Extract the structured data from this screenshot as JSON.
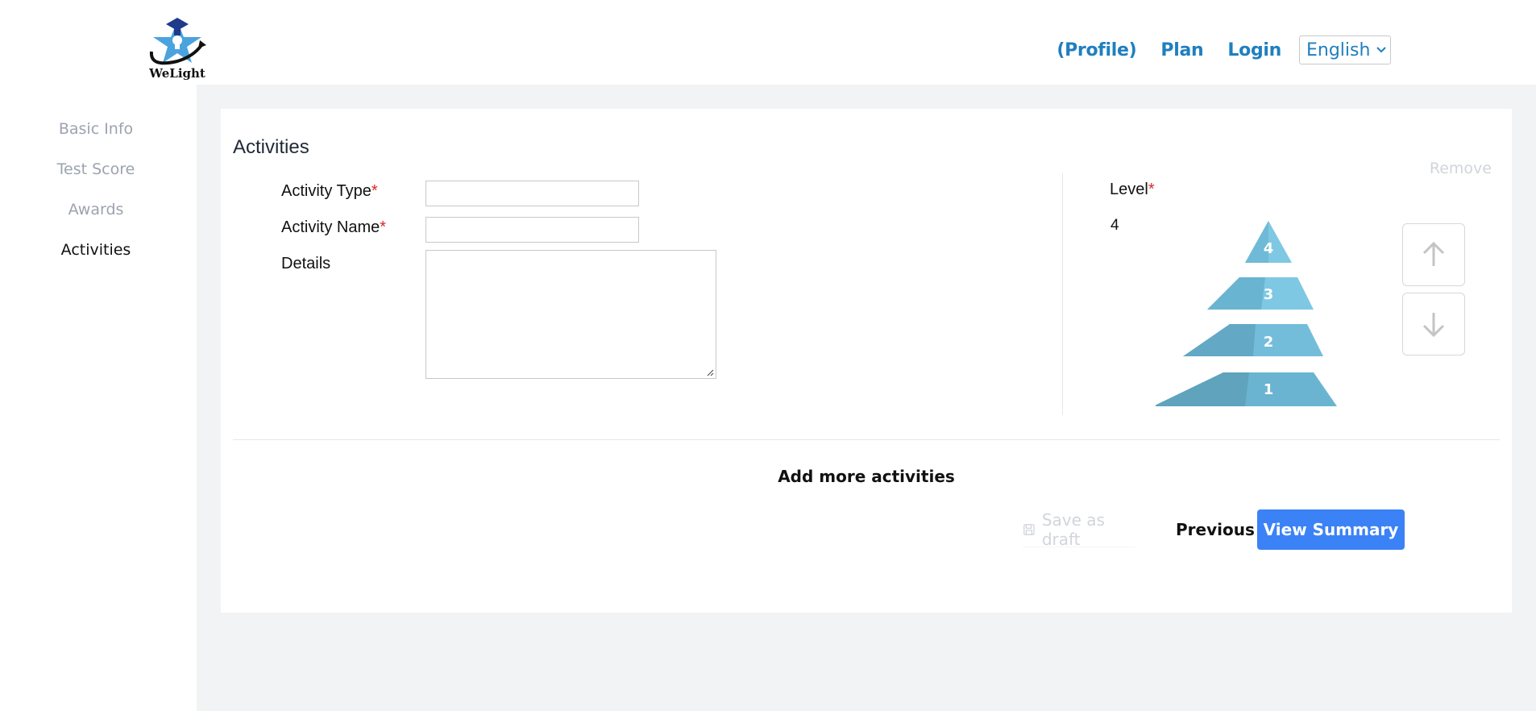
{
  "header": {
    "logo_text": "WeLight",
    "nav": {
      "profile": "(Profile)",
      "plan": "Plan",
      "login": "Login"
    },
    "language": {
      "selected": "English",
      "icon": "chevron-down-icon"
    }
  },
  "sidebar": {
    "items": [
      {
        "label": "Basic Info",
        "active": false
      },
      {
        "label": "Test Score",
        "active": false
      },
      {
        "label": "Awards",
        "active": false
      },
      {
        "label": "Activities",
        "active": true
      }
    ]
  },
  "form": {
    "title": "Activities",
    "remove_label": "Remove",
    "activity_type": {
      "label": "Activity Type",
      "required_mark": "*",
      "value": ""
    },
    "activity_name": {
      "label": "Activity Name",
      "required_mark": "*",
      "value": ""
    },
    "details": {
      "label": "Details",
      "value": ""
    },
    "level": {
      "label": "Level",
      "required_mark": "*",
      "value": "4",
      "pyramid_tiers": [
        "4",
        "3",
        "2",
        "1"
      ],
      "up_icon": "arrow-up-icon",
      "down_icon": "arrow-down-icon"
    },
    "add_more_label": "Add more activities"
  },
  "footer_actions": {
    "save_draft": "Save as draft",
    "save_icon": "floppy-disk-icon",
    "previous": "Previous",
    "view_summary": "View Summary"
  },
  "colors": {
    "accent": "#3b82f6",
    "nav_link": "#1f7fbf",
    "page_bg": "#f2f3f5",
    "required": "#dc2626",
    "pyramid_light": "#7ec8e3",
    "pyramid_dark": "#5fa3bd"
  }
}
